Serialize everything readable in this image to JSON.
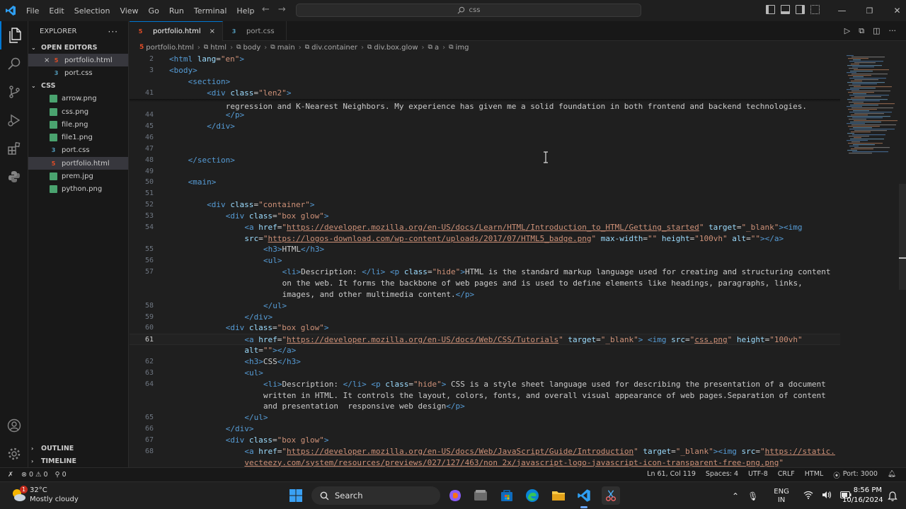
{
  "titlebar": {
    "menus": [
      "File",
      "Edit",
      "Selection",
      "View",
      "Go",
      "Run",
      "Terminal",
      "Help"
    ],
    "search": "css"
  },
  "sidebar": {
    "title": "EXPLORER",
    "open_editors_label": "OPEN EDITORS",
    "open_editors": [
      {
        "name": "portfolio.html",
        "type": "html",
        "close": "×"
      },
      {
        "name": "port.css",
        "type": "css"
      }
    ],
    "folder_label": "CSS",
    "files": [
      {
        "name": "arrow.png",
        "type": "png"
      },
      {
        "name": "css.png",
        "type": "png"
      },
      {
        "name": "file.png",
        "type": "png"
      },
      {
        "name": "file1.png",
        "type": "png"
      },
      {
        "name": "port.css",
        "type": "css"
      },
      {
        "name": "portfolio.html",
        "type": "html",
        "selected": true
      },
      {
        "name": "prem.jpg",
        "type": "png"
      },
      {
        "name": "python.png",
        "type": "png"
      }
    ],
    "outline_label": "OUTLINE",
    "timeline_label": "TIMELINE"
  },
  "tabs": [
    {
      "label": "portfolio.html",
      "active": true,
      "close": "×"
    },
    {
      "label": "port.css",
      "active": false
    }
  ],
  "breadcrumb": [
    "portfolio.html",
    "html",
    "body",
    "main",
    "div.container",
    "div.box.glow",
    "a",
    "img"
  ],
  "code_lines": [
    {
      "n": "2",
      "indent": 0,
      "html": "<span class='tg'>&lt;html</span> <span class='at'>lang</span>=<span class='st'>\"en\"</span><span class='tg'>&gt;</span>"
    },
    {
      "n": "3",
      "indent": 0,
      "html": "<span class='tg'>&lt;body&gt;</span>"
    },
    {
      "n": "",
      "indent": 1,
      "html": "<span class='tg'>&lt;section&gt;</span>"
    },
    {
      "n": "41",
      "indent": 2,
      "html": "<span class='tg'>&lt;div</span> <span class='at'>class</span>=<span class='st'>\"len2\"</span><span class='tg'>&gt;</span>"
    },
    {
      "n": "",
      "indent": 3,
      "html": "regression and K-Nearest Neighbors. My experience has given me a solid foundation in both frontend and backend technologies."
    },
    {
      "n": "44",
      "indent": 3,
      "html": "<span class='tg'>&lt;/p&gt;</span>"
    },
    {
      "n": "45",
      "indent": 2,
      "html": "<span class='tg'>&lt;/div&gt;</span>"
    },
    {
      "n": "46",
      "indent": 0,
      "html": ""
    },
    {
      "n": "47",
      "indent": 0,
      "html": ""
    },
    {
      "n": "48",
      "indent": 1,
      "html": "<span class='tg'>&lt;/section&gt;</span>"
    },
    {
      "n": "49",
      "indent": 0,
      "html": ""
    },
    {
      "n": "50",
      "indent": 1,
      "html": "<span class='tg'>&lt;main&gt;</span>"
    },
    {
      "n": "51",
      "indent": 0,
      "html": ""
    },
    {
      "n": "52",
      "indent": 2,
      "html": "<span class='tg'>&lt;div</span> <span class='at'>class</span>=<span class='st'>\"container\"</span><span class='tg'>&gt;</span>"
    },
    {
      "n": "53",
      "indent": 3,
      "html": "<span class='tg'>&lt;div</span> <span class='at'>class</span>=<span class='st'>\"box glow\"</span><span class='tg'>&gt;</span>"
    },
    {
      "n": "54",
      "indent": 4,
      "html": "<span class='tg'>&lt;a</span> <span class='at'>href</span>=<span class='st'>\"</span><span class='lk'>https://developer.mozilla.org/en-US/docs/Learn/HTML/Introduction_to_HTML/Getting_started</span><span class='st'>\"</span> <span class='at'>target</span>=<span class='st'>\"_blank\"</span><span class='tg'>&gt;&lt;img</span>"
    },
    {
      "n": "",
      "indent": 4,
      "html": "<span class='at'>src</span>=<span class='st'>\"</span><span class='lk'>https://logos-download.com/wp-content/uploads/2017/07/HTML5_badge.png</span><span class='st'>\"</span> <span class='at'>max-width</span>=<span class='st'>\"\"</span> <span class='at'>height</span>=<span class='st'>\"100vh\"</span> <span class='at'>alt</span>=<span class='st'>\"\"</span><span class='tg'>&gt;&lt;/a&gt;</span>"
    },
    {
      "n": "55",
      "indent": 5,
      "html": "<span class='tg'>&lt;h3&gt;</span>HTML<span class='tg'>&lt;/h3&gt;</span>"
    },
    {
      "n": "56",
      "indent": 5,
      "html": "<span class='tg'>&lt;ul&gt;</span>"
    },
    {
      "n": "57",
      "indent": 6,
      "html": "<span class='tg'>&lt;li&gt;</span>Description: <span class='tg'>&lt;/li&gt;</span> <span class='tg'>&lt;p</span> <span class='at'>class</span>=<span class='st'>\"hide\"</span><span class='tg'>&gt;</span>HTML is the standard markup language used for creating and structuring content"
    },
    {
      "n": "",
      "indent": 6,
      "html": "on the web. It forms the backbone of web pages and is used to define elements like headings, paragraphs, links,"
    },
    {
      "n": "",
      "indent": 6,
      "html": "images, and other multimedia content.<span class='tg'>&lt;/p&gt;</span>"
    },
    {
      "n": "58",
      "indent": 5,
      "html": "<span class='tg'>&lt;/ul&gt;</span>"
    },
    {
      "n": "59",
      "indent": 4,
      "html": "<span class='tg'>&lt;/div&gt;</span>"
    },
    {
      "n": "60",
      "indent": 3,
      "html": "<span class='tg'>&lt;div</span> <span class='at'>class</span>=<span class='st'>\"box glow\"</span><span class='tg'>&gt;</span>"
    },
    {
      "n": "61",
      "indent": 4,
      "cur": true,
      "html": "<span class='tg'>&lt;a</span> <span class='at'>href</span>=<span class='st'>\"</span><span class='lk'>https://developer.mozilla.org/en-US/docs/Web/CSS/Tutorials</span><span class='st'>\"</span> <span class='at'>target</span>=<span class='st'>\"_blank\"</span><span class='tg'>&gt;</span> <span class='tg'>&lt;img</span> <span class='at'>src</span>=<span class='st'>\"</span><span class='lk'>css.png</span><span class='st'>\"</span> <span class='at'>height</span>=<span class='st'>\"100vh\"</span>"
    },
    {
      "n": "",
      "indent": 4,
      "html": "<span class='at'>alt</span>=<span class='st'>\"\"</span><span class='tg'>&gt;&lt;/a&gt;</span>"
    },
    {
      "n": "62",
      "indent": 4,
      "html": "<span class='tg'>&lt;h3&gt;</span>CSS<span class='tg'>&lt;/h3&gt;</span>"
    },
    {
      "n": "63",
      "indent": 4,
      "html": "<span class='tg'>&lt;ul&gt;</span>"
    },
    {
      "n": "64",
      "indent": 5,
      "html": "<span class='tg'>&lt;li&gt;</span>Description: <span class='tg'>&lt;/li&gt;</span> <span class='tg'>&lt;p</span> <span class='at'>class</span>=<span class='st'>\"hide\"</span><span class='tg'>&gt;</span> CSS is a style sheet language used for describing the presentation of a document"
    },
    {
      "n": "",
      "indent": 5,
      "html": "written in HTML. It controls the layout, colors, fonts, and overall visual appearance of web pages.Separation of content"
    },
    {
      "n": "",
      "indent": 5,
      "html": "and presentation  responsive web design<span class='tg'>&lt;/p&gt;</span>"
    },
    {
      "n": "65",
      "indent": 4,
      "html": "<span class='tg'>&lt;/ul&gt;</span>"
    },
    {
      "n": "66",
      "indent": 3,
      "html": "<span class='tg'>&lt;/div&gt;</span>"
    },
    {
      "n": "67",
      "indent": 3,
      "html": "<span class='tg'>&lt;div</span> <span class='at'>class</span>=<span class='st'>\"box glow\"</span><span class='tg'>&gt;</span>"
    },
    {
      "n": "68",
      "indent": 4,
      "html": "<span class='tg'>&lt;a</span> <span class='at'>href</span>=<span class='st'>\"</span><span class='lk'>https://developer.mozilla.org/en-US/docs/Web/JavaScript/Guide/Introduction</span><span class='st'>\"</span> <span class='at'>target</span>=<span class='st'>\"_blank\"</span><span class='tg'>&gt;&lt;img</span> <span class='at'>src</span>=<span class='st'>\"</span><span class='lk'>https://static.</span>"
    },
    {
      "n": "",
      "indent": 4,
      "html": "<span class='lk'>vecteezy.com/system/resources/previews/027/127/463/non_2x/javascript-logo-javascript-icon-transparent-free-png.png</span><span class='st'>\"</span>"
    }
  ],
  "status": {
    "errors": "0",
    "warnings": "0",
    "ports": "0",
    "position": "Ln 61, Col 119",
    "spaces": "Spaces: 4",
    "encoding": "UTF-8",
    "eol": "CRLF",
    "language": "HTML",
    "port": "Port: 3000"
  },
  "taskbar": {
    "weather_temp": "32°C",
    "weather_desc": "Mostly cloudy",
    "weather_badge": "1",
    "search_label": "Search",
    "lang_top": "ENG",
    "lang_bottom": "IN",
    "time": "8:56 PM",
    "date": "10/16/2024"
  },
  "colors": {
    "accent": "#0078d4",
    "tag": "#569cd6",
    "attr": "#9cdcfe",
    "string": "#ce9178"
  }
}
